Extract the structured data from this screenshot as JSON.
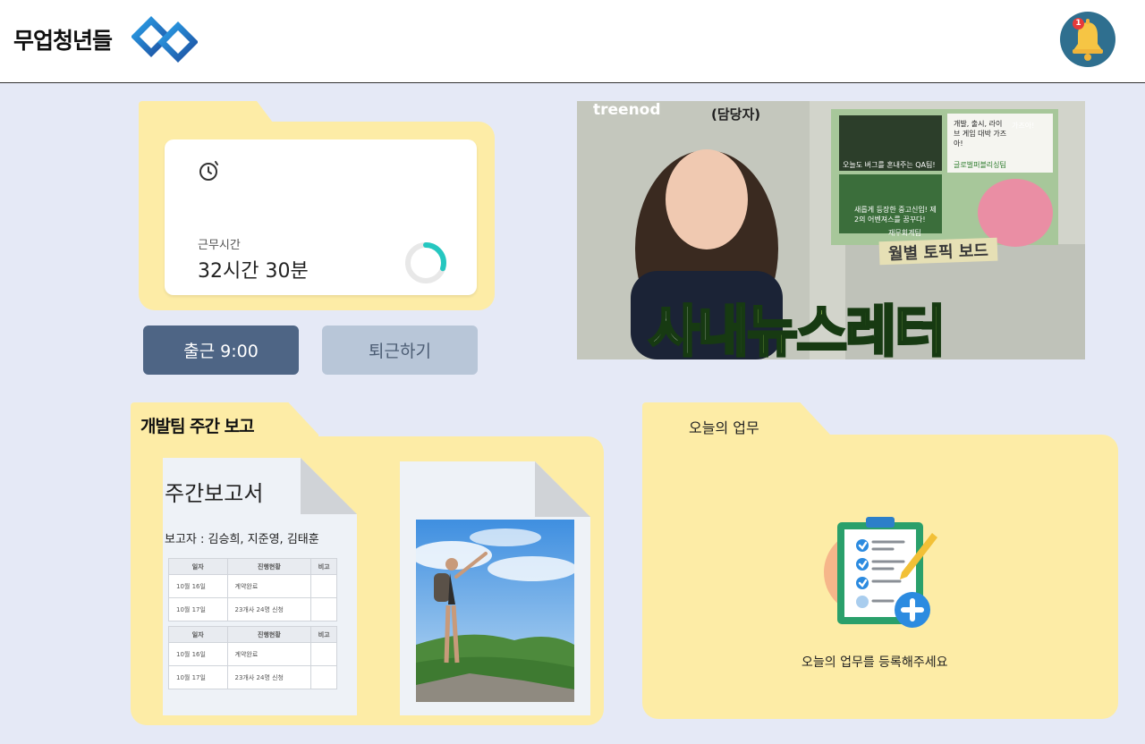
{
  "header": {
    "brand": "무업청년들",
    "logo_icon": "diamond-chain-logo",
    "notification": {
      "icon": "bell-icon",
      "count": "1"
    }
  },
  "worktime": {
    "icon": "clock-icon",
    "label": "근무시간",
    "value": "32시간 30분",
    "progress": 0.3
  },
  "buttons": {
    "clock_in": "출근 9:00",
    "clock_out": "퇴근하기"
  },
  "banner": {
    "brand": "treenod",
    "role": "(담당자)",
    "topic": "월별 토픽 보드",
    "title_white": "사내",
    "title_green": "뉴스레터",
    "cards": [
      "오늘도 버그를 혼내주는 QA팀!",
      "개발, 출시, 라이브 게임 대박 가즈아!",
      "가즈아!",
      "글로벌퍼블리싱팀",
      "새롭게 등장한 중고신입! 제2의 어벤져스를 꿈꾸다!",
      "재무회계팀"
    ]
  },
  "weekly_report": {
    "title": "개발팀 주간 보고",
    "doc_title": "주간보고서",
    "reporter": "보고자 : 김승희, 지준영, 김태훈",
    "table_headers": [
      "일자",
      "진행현황",
      "비고"
    ],
    "table_rows": [
      [
        "10월 16일",
        "계약완료",
        ""
      ],
      [
        "10월 17일",
        "23개사 24명 신청",
        ""
      ]
    ]
  },
  "today": {
    "title": "오늘의 업무",
    "empty_message": "오늘의 업무를 등록해주세요",
    "icon": "clipboard-add-icon"
  },
  "colors": {
    "background": "#e5e9f6",
    "folder": "#fdeca6",
    "clock_in_button": "#4e6585",
    "clock_out_button": "#b8c6d8",
    "progress_ring": "#25c7c0"
  }
}
